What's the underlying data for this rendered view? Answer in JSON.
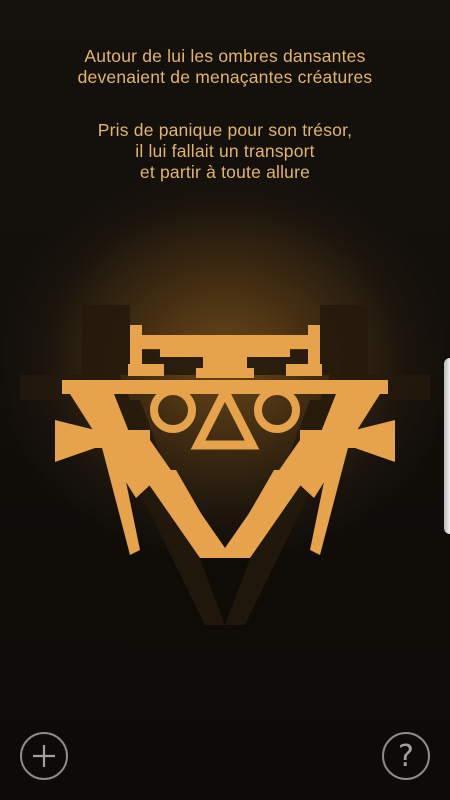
{
  "poem": {
    "stanza1": [
      "Autour de lui les ombres dansantes",
      "devenaient de menaçantes créatures"
    ],
    "stanza2": [
      "Pris de panique pour son trésor,",
      "il lui fallait un transport",
      "et partir à toute allure"
    ]
  },
  "emblem": {
    "icon": "golden-vehicle-emblem",
    "color": "#e6a34b",
    "shadow_color": "#2a1d0e"
  },
  "controls": {
    "add_icon": "plus-icon",
    "help_icon": "question-icon",
    "help_glyph": "?"
  },
  "colors": {
    "text": "#e3b46a",
    "background": "#0e0b08",
    "button_outline": "#8c8c8c"
  }
}
